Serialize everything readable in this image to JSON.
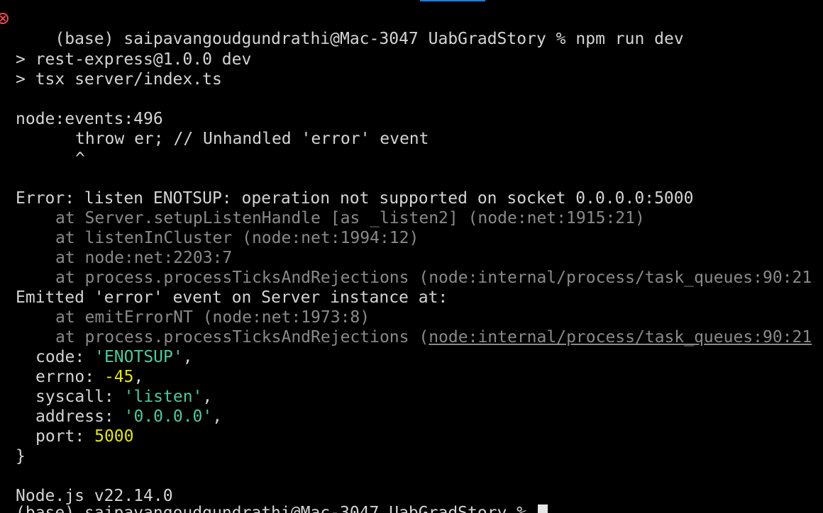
{
  "prompt": {
    "env": "(base)",
    "user_host": "saipavangoudgundrathi@Mac-3047",
    "dir": "UabGradStory",
    "symbol": "%",
    "command": "npm run dev"
  },
  "npm": {
    "line1": "> rest-express@1.0.0 dev",
    "line2": "> tsx server/index.ts"
  },
  "throw": {
    "location": "node:events:496",
    "statement": "throw er; // Unhandled 'error' event",
    "caret": "^"
  },
  "error": {
    "message": "Error: listen ENOTSUP: operation not supported on socket 0.0.0.0:5000",
    "stack": [
      "at Server.setupListenHandle [as _listen2] (node:net:1915:21)",
      "at listenInCluster (node:net:1994:12)",
      "at node:net:2203:7",
      "at process.processTicksAndRejections (node:internal/process/task_queues:90:21"
    ],
    "emitted": "Emitted 'error' event on Server instance at:",
    "emitted_stack": [
      "at emitErrorNT (node:net:1973:8)",
      "at process.processTicksAndRejections (node:internal/process/task_queues:90:21"
    ],
    "emitted_link_prefix": "at process.processTicksAndRejections (",
    "emitted_link": "node:internal/process/task_queues:90:21"
  },
  "props": {
    "code_key": "code: ",
    "code_value": "'ENOTSUP'",
    "errno_key": "errno: ",
    "errno_value": "-45",
    "syscall_key": "syscall: ",
    "syscall_value": "'listen'",
    "address_key": "address: ",
    "address_value": "'0.0.0.0'",
    "port_key": "port: ",
    "port_value": "5000",
    "comma": ",",
    "close": "}"
  },
  "node_version": "Node.js v22.14.0",
  "colors": {
    "background": "#000000",
    "text": "#d4d4d4",
    "dim": "#8a8a8a",
    "string": "#4ec9a0",
    "number": "#e5e510",
    "error_icon": "#f14c4c",
    "accent": "#0a84ff"
  }
}
